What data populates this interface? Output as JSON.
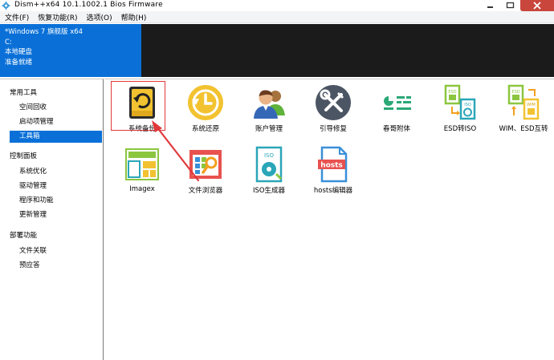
{
  "window": {
    "title": "Dism++x64 10.1.1002.1 Bios Firmware",
    "controls": [
      "minimize-icon",
      "maximize-icon",
      "close-icon"
    ]
  },
  "menu": [
    {
      "label": "文件(F)"
    },
    {
      "label": "恢复功能(R)"
    },
    {
      "label": "选项(O)"
    },
    {
      "label": "帮助(H)"
    }
  ],
  "session": {
    "os": "*Windows 7 旗舰版 x64",
    "drive": "C:",
    "disk": "本地硬盘",
    "status": "准备就绪"
  },
  "sidebar": {
    "groups": [
      {
        "label": "常用工具",
        "items": [
          "空间回收",
          "启动项管理",
          "工具箱"
        ]
      },
      {
        "label": "控制面板",
        "items": [
          "系统优化",
          "驱动管理",
          "程序和功能",
          "更新管理"
        ]
      },
      {
        "label": "部署功能",
        "items": [
          "文件关联",
          "预应答"
        ]
      }
    ],
    "selected": "工具箱"
  },
  "tools": [
    {
      "label": "系统备份",
      "icon": "system-backup-icon"
    },
    {
      "label": "系统还原",
      "icon": "system-restore-icon"
    },
    {
      "label": "账户管理",
      "icon": "account-management-icon"
    },
    {
      "label": "引导修复",
      "icon": "boot-repair-icon"
    },
    {
      "label": "春哥附体",
      "icon": "chunge-attach-icon"
    },
    {
      "label": "ESD转ISO",
      "icon": "esd-to-iso-icon"
    },
    {
      "label": "WIM、ESD互转",
      "icon": "wim-esd-convert-icon"
    },
    {
      "label": "Imagex",
      "icon": "imagex-icon"
    },
    {
      "label": "文件浏览器",
      "icon": "file-browser-icon"
    },
    {
      "label": "ISO生成器",
      "icon": "iso-generator-icon"
    },
    {
      "label": "hosts编辑器",
      "icon": "hosts-editor-icon"
    }
  ],
  "icon_text": {
    "esd": "ESD",
    "iso": "ISO",
    "wim": "WIM",
    "hosts": "hosts"
  },
  "colors": {
    "accent_blue": "#0a70d8",
    "highlight_red": "#e0383b",
    "dark_panel": "#1b1b1b"
  }
}
